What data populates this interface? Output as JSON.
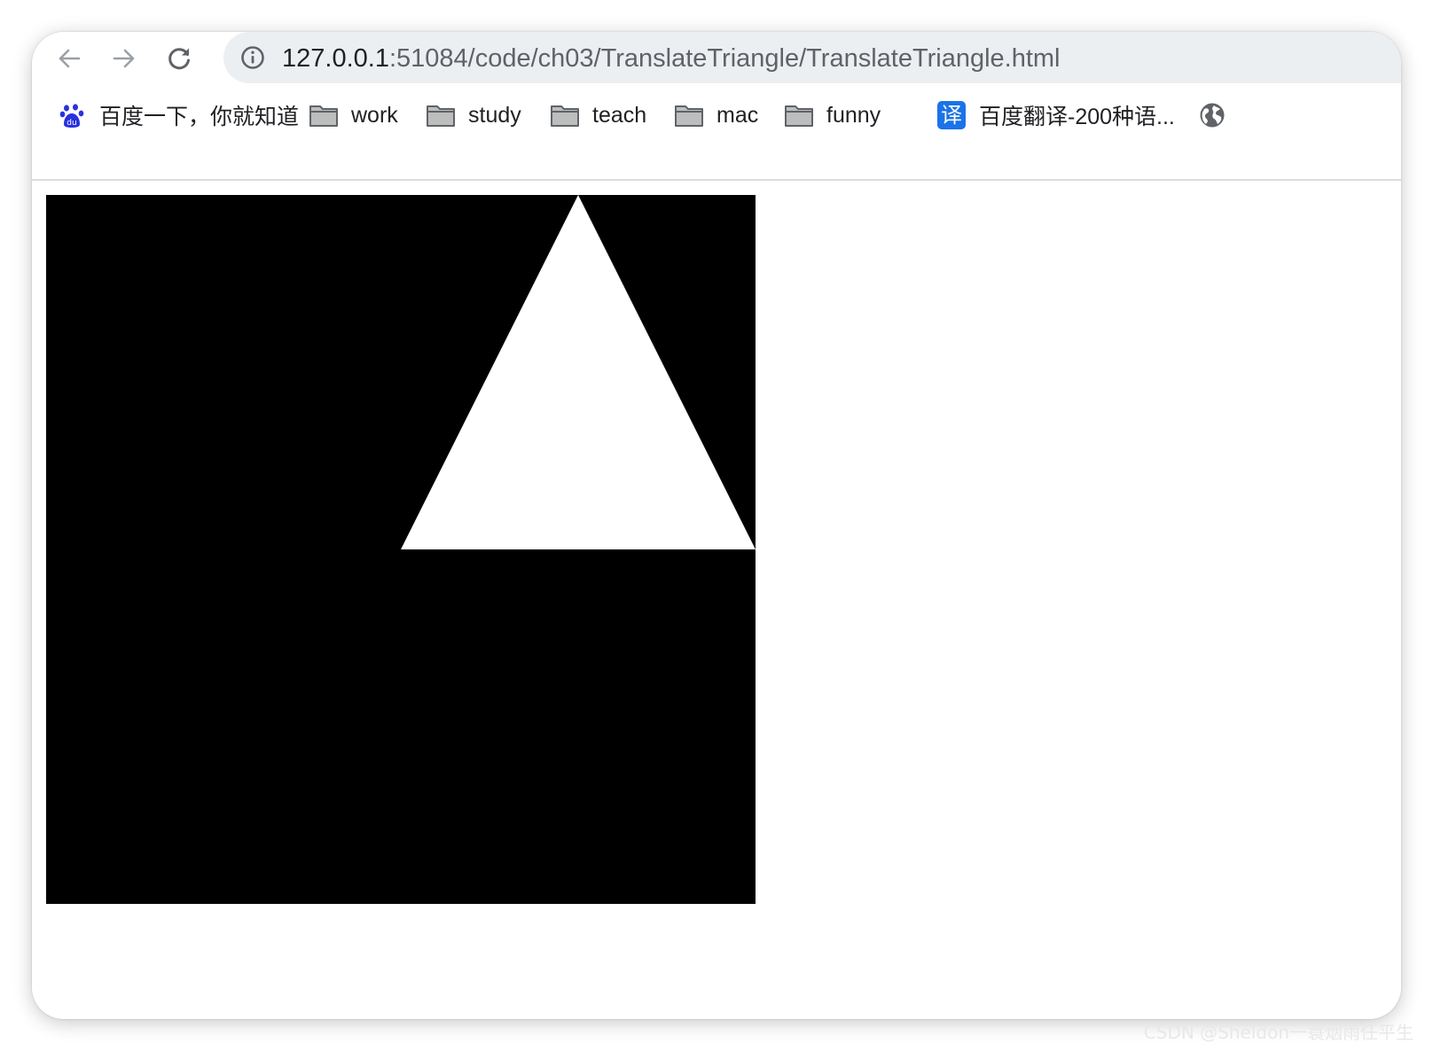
{
  "browser": {
    "back_icon": "arrow-left-icon",
    "forward_icon": "arrow-right-icon",
    "reload_icon": "reload-icon",
    "address_bar": {
      "security_icon": "info-circle-icon",
      "host": "127.0.0.1",
      "path": ":51084/code/ch03/TranslateTriangle/TranslateTriangle.html"
    }
  },
  "bookmarks": [
    {
      "label": "百度一下，你就知道",
      "icon": "baidu-paw-icon"
    },
    {
      "label": "work",
      "icon": "folder-icon"
    },
    {
      "label": "study",
      "icon": "folder-icon"
    },
    {
      "label": "teach",
      "icon": "folder-icon"
    },
    {
      "label": "mac",
      "icon": "folder-icon"
    },
    {
      "label": "funny",
      "icon": "folder-icon"
    },
    {
      "label": "百度翻译-200种语...",
      "icon": "translate-icon",
      "badge": "译"
    },
    {
      "label": "",
      "icon": "globe-icon"
    }
  ],
  "canvas": {
    "background": "#000000",
    "triangle_color": "#ffffff",
    "shape": "triangle"
  },
  "watermark": "CSDN @Sheldon一蓑烟雨任平生",
  "colors": {
    "omnibox_bg": "#eceff1",
    "translate_badge": "#1a73e8",
    "baidu_blue": "#2932e1"
  }
}
